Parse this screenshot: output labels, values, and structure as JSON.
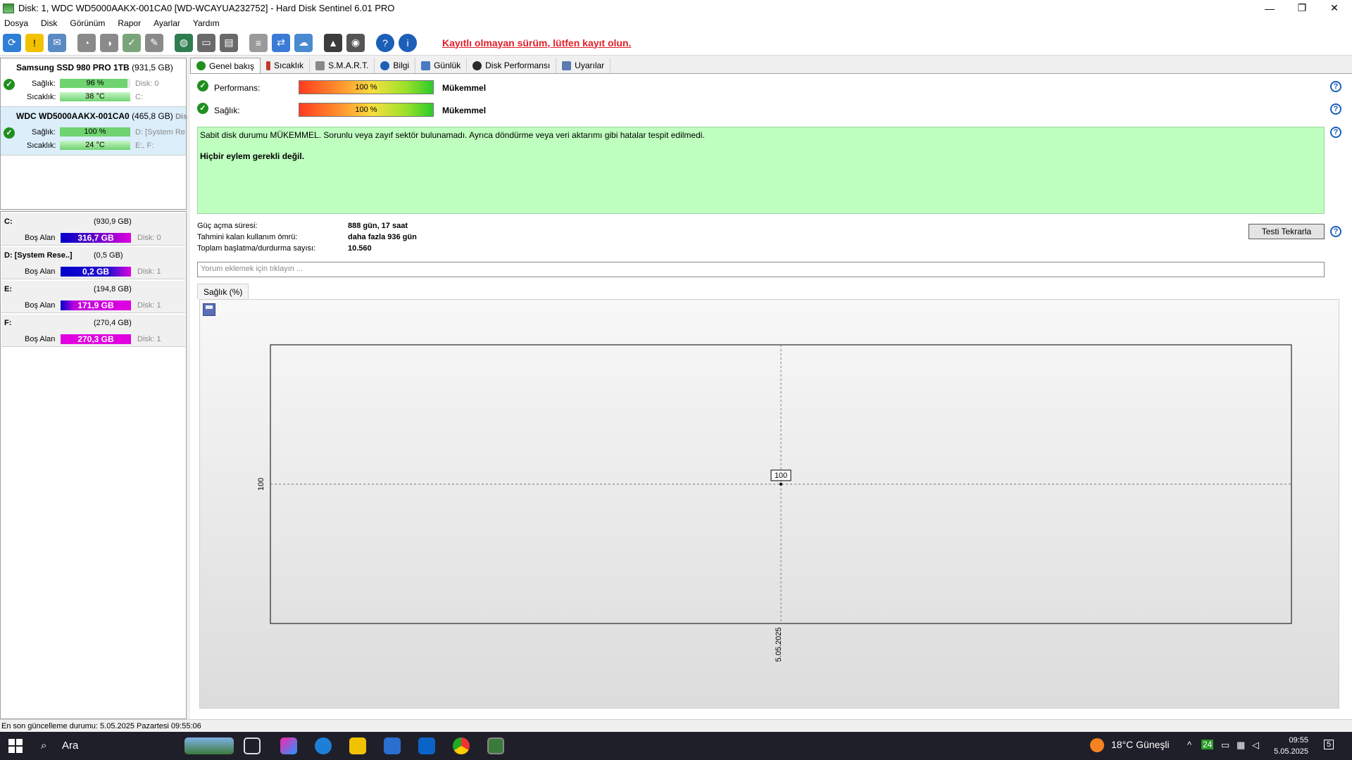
{
  "window": {
    "title": "Disk: 1, WDC WD5000AAKX-001CA0 [WD-WCAYUA232752]  -  Hard Disk Sentinel 6.01 PRO",
    "minimize": "—",
    "maximize": "❐",
    "close": "✕"
  },
  "menu": [
    "Dosya",
    "Disk",
    "Görünüm",
    "Rapor",
    "Ayarlar",
    "Yardım"
  ],
  "toolbar": {
    "register_link": "Kayıtlı olmayan sürüm, lütfen kayıt olun."
  },
  "disks": [
    {
      "name": "Samsung SSD 980 PRO 1TB",
      "size": "(931,5 GB)",
      "health_label": "Sağlık:",
      "health": "96 %",
      "health_pct": 96,
      "temp_label": "Sıcaklık:",
      "temp": "38 °C",
      "disk_info": "Disk: 0",
      "vol_info": "C:"
    },
    {
      "name": "WDC WD5000AAKX-001CA0",
      "size": "(465,8 GB)",
      "size_suffix": "Dis",
      "health_label": "Sağlık:",
      "health": "100 %",
      "health_pct": 100,
      "temp_label": "Sıcaklık:",
      "temp": "24 °C",
      "disk_info": "D: [System Re",
      "vol_info": "E:, F:"
    }
  ],
  "volumes": [
    {
      "name": "C:",
      "size": "(930,9 GB)",
      "free_label": "Boş Alan",
      "free": "316,7 GB",
      "disk": "Disk: 0"
    },
    {
      "name": "D: [System Rese..]",
      "size": "(0,5 GB)",
      "free_label": "Boş Alan",
      "free": "0,2 GB",
      "disk": "Disk: 1"
    },
    {
      "name": "E:",
      "size": "(194,8 GB)",
      "free_label": "Boş Alan",
      "free": "171,9 GB",
      "disk": "Disk: 1"
    },
    {
      "name": "F:",
      "size": "(270,4 GB)",
      "free_label": "Boş Alan",
      "free": "270,3 GB",
      "disk": "Disk: 1"
    }
  ],
  "tabs": [
    "Genel bakış",
    "Sıcaklık",
    "S.M.A.R.T.",
    "Bilgi",
    "Günlük",
    "Disk Performansı",
    "Uyarılar"
  ],
  "overview": {
    "performance_label": "Performans:",
    "performance_value": "100 %",
    "performance_pct": 100,
    "performance_verdict": "Mükemmel",
    "health_label": "Sağlık:",
    "health_value": "100 %",
    "health_pct": 100,
    "health_verdict": "Mükemmel",
    "status_text": "Sabit disk durumu MÜKEMMEL. Sorunlu veya zayıf sektör bulunamadı. Ayrıca döndürme veya veri aktarımı gibi hatalar tespit edilmedi.",
    "action_text": "Hiçbir eylem gerekli değil.",
    "stats": [
      {
        "label": "Güç açma süresi:",
        "value": "888 gün, 17 saat"
      },
      {
        "label": "Tahmini kalan kullanım ömrü:",
        "value": "daha fazla 936 gün"
      },
      {
        "label": "Toplam başlatma/durdurma sayısı:",
        "value": "10.560"
      }
    ],
    "retest_button": "Testi Tekrarla",
    "comment_placeholder": "Yorum eklemek için tıklayın ...",
    "chart_tab": "Sağlık (%)",
    "help_glyph": "?"
  },
  "chart_data": {
    "type": "line",
    "x": [
      "5.05.2025"
    ],
    "series": [
      {
        "values": [
          100
        ]
      }
    ],
    "point_labels": [
      "100"
    ],
    "y_tick_labels": [
      "100"
    ],
    "x_tick_labels": [
      "5.05.2025"
    ],
    "grid": true
  },
  "statusbar": "En son güncelleme durumu: 5.05.2025 Pazartesi 09:55:06",
  "taskbar": {
    "search": "Ara",
    "weather": "18°C  Güneşli",
    "time": "09:55",
    "date": "5.05.2025",
    "tray_lang": "24",
    "notification_count": "5"
  }
}
